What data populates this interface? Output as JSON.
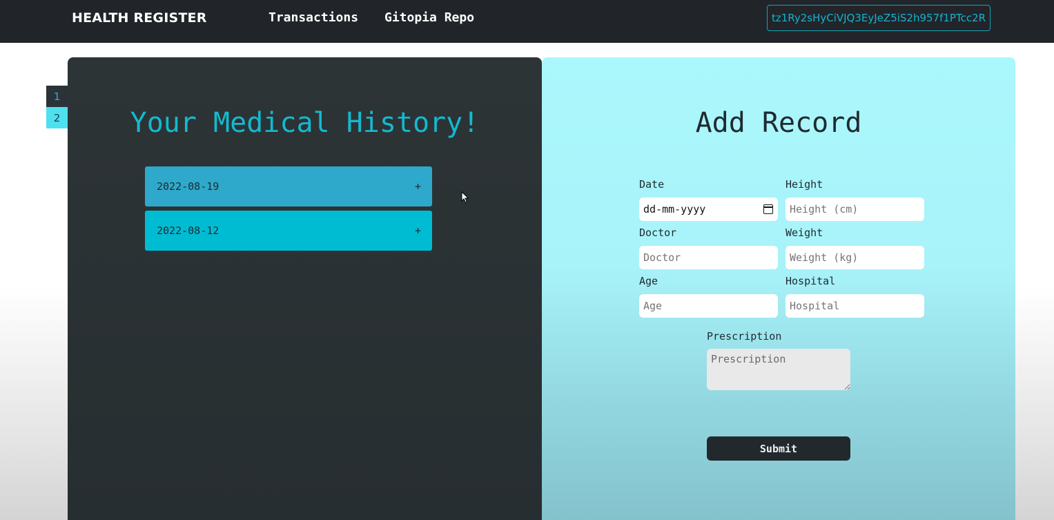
{
  "navbar": {
    "brand": "HEALTH REGISTER",
    "links": [
      {
        "label": "Transactions"
      },
      {
        "label": "Gitopia Repo"
      }
    ],
    "wallet_address": "tz1Ry2sHyCiVJQ3EyJeZ5iS2h957f1PTcc2R"
  },
  "pagination": {
    "pages": [
      "1",
      "2"
    ],
    "active_page": "1"
  },
  "history": {
    "title": "Your Medical History!",
    "records": [
      {
        "date": "2022-08-19",
        "toggle": "+"
      },
      {
        "date": "2022-08-12",
        "toggle": "+"
      }
    ]
  },
  "form": {
    "title": "Add Record",
    "date": {
      "label": "Date",
      "value": "dd-mm-yyyy"
    },
    "height": {
      "label": "Height",
      "placeholder": "Height (cm)"
    },
    "doctor": {
      "label": "Doctor",
      "placeholder": "Doctor"
    },
    "weight": {
      "label": "Weight",
      "placeholder": "Weight (kg)"
    },
    "age": {
      "label": "Age",
      "placeholder": "Age"
    },
    "hospital": {
      "label": "Hospital",
      "placeholder": "Hospital"
    },
    "prescription": {
      "label": "Prescription",
      "placeholder": "Prescription"
    },
    "submit_label": "Submit"
  },
  "colors": {
    "navbar_bg": "#212529",
    "accent": "#17a2b8",
    "left_panel": "#2d3436",
    "right_panel": "#aaf7fc",
    "record_1": "#2fa9cb",
    "record_2": "#00bcd2"
  }
}
